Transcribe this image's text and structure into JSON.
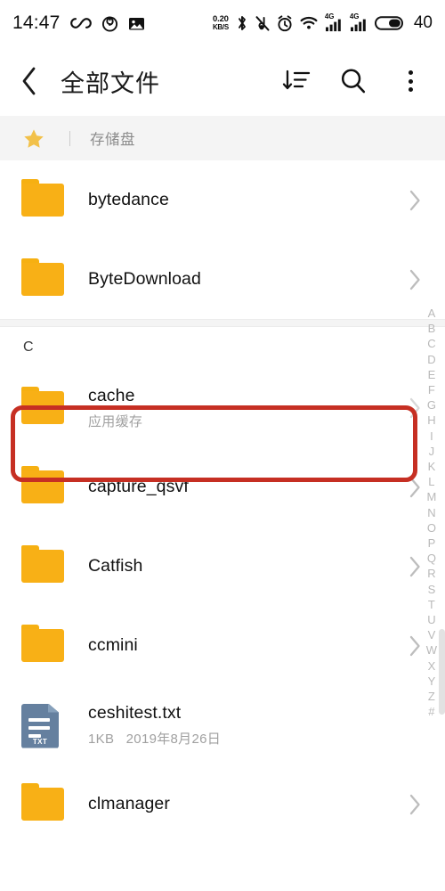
{
  "statusbar": {
    "time": "14:47",
    "left_icons": [
      "infinity-icon",
      "spiral-icon",
      "image-icon"
    ],
    "netspeed_value": "0.20",
    "netspeed_unit": "KB/S",
    "right_icons": [
      "bluetooth-icon",
      "mute-icon",
      "alarm-icon",
      "wifi-icon",
      "signal-4g-icon",
      "signal-4g-icon",
      "battery-icon"
    ],
    "signal_label": "4G",
    "battery_percent": "40"
  },
  "appbar": {
    "back_label": "‹",
    "title": "全部文件",
    "sort_label": "sort-descending-icon",
    "search_label": "search-icon",
    "more_label": "more-options-icon"
  },
  "breadcrumb": {
    "star_label": "star-icon",
    "path": "存储盘"
  },
  "list": {
    "items": [
      {
        "type": "folder",
        "name": "bytedance",
        "sub": "",
        "chevron": "›"
      },
      {
        "type": "folder",
        "name": "ByteDownload",
        "sub": "",
        "chevron": "›"
      },
      {
        "type": "folder",
        "name": "cache",
        "sub": "应用缓存",
        "chevron": "›"
      },
      {
        "type": "folder",
        "name": "capture_qsvf",
        "sub": "",
        "chevron": "›"
      },
      {
        "type": "folder",
        "name": "Catfish",
        "sub": "",
        "chevron": "›"
      },
      {
        "type": "folder",
        "name": "ccmini",
        "sub": "",
        "chevron": "›"
      },
      {
        "type": "txt",
        "name": "ceshitest.txt",
        "sub": "1KB   2019年8月26日",
        "chevron": "",
        "badge": "TXT"
      },
      {
        "type": "folder",
        "name": "clmanager",
        "sub": "",
        "chevron": "›"
      }
    ],
    "section_letter": "C"
  },
  "az_index": {
    "letters": [
      "A",
      "B",
      "C",
      "D",
      "E",
      "F",
      "G",
      "H",
      "I",
      "J",
      "K",
      "L",
      "M",
      "N",
      "O",
      "P",
      "Q",
      "R",
      "S",
      "T",
      "U",
      "V",
      "W",
      "X",
      "Y",
      "Z",
      "#"
    ]
  },
  "annotation": {
    "target": "cache",
    "color": "#c62f23"
  },
  "colors": {
    "folder": "#f8b016",
    "txt_icon": "#65809f",
    "band": "#f4f4f4",
    "accent_red": "#c62f23",
    "muted_text": "#a0a0a0"
  }
}
